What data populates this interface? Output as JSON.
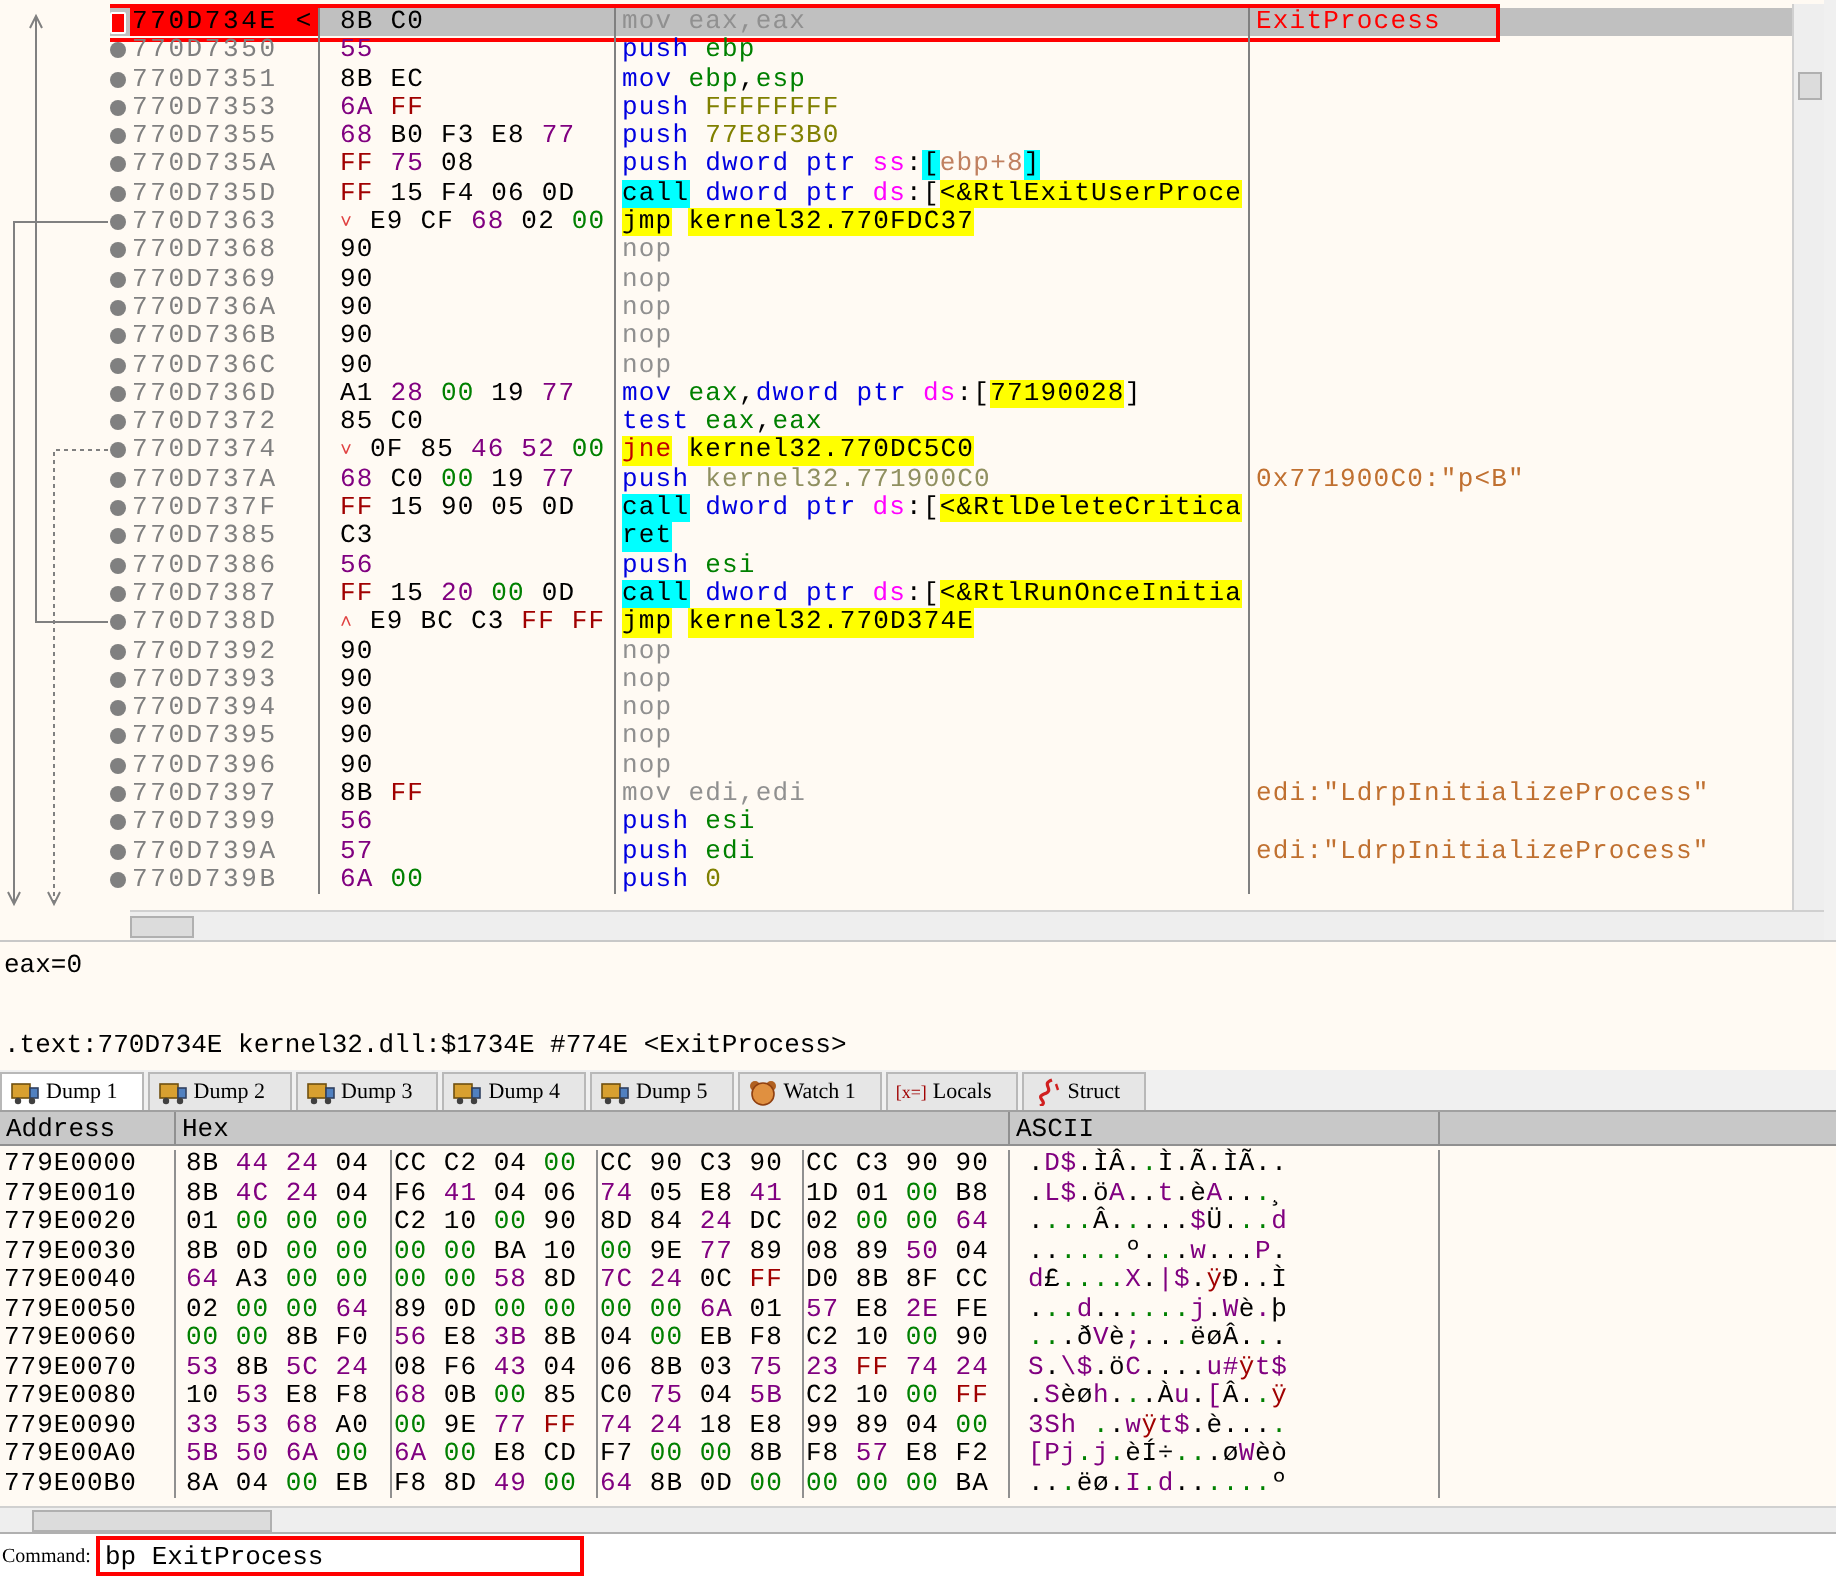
{
  "disassembly": {
    "rows": [
      {
        "address": "770D734E <",
        "bytes": "8B C0",
        "mnemonic": "mov",
        "kind": "gray",
        "operands": [
          {
            "text": "eax,eax",
            "kind": "gray"
          }
        ],
        "comment": {
          "text": "ExitProcess",
          "kind": "label"
        },
        "selected": true,
        "breakpoint": true,
        "boxed": true
      },
      {
        "address": "770D7350",
        "bytes": "55",
        "mnemonic": "push",
        "kind": "op",
        "operands": [
          {
            "text": "ebp",
            "kind": "reg"
          }
        ],
        "selected": false,
        "breakpoint": false,
        "boxed": false
      },
      {
        "address": "770D7351",
        "bytes": "8B EC",
        "mnemonic": "mov",
        "kind": "op",
        "operands": [
          {
            "text": "ebp",
            "kind": "reg"
          },
          {
            "text": ",",
            "kind": "plain"
          },
          {
            "text": "esp",
            "kind": "reg"
          }
        ],
        "selected": false,
        "breakpoint": false,
        "boxed": false
      },
      {
        "address": "770D7353",
        "bytes": "6A FF",
        "mnemonic": "push",
        "kind": "op",
        "operands": [
          {
            "text": "FFFFFFFF",
            "kind": "num"
          }
        ],
        "selected": false,
        "breakpoint": false,
        "boxed": false
      },
      {
        "address": "770D7355",
        "bytes": "68 B0 F3 E8 77",
        "mnemonic": "push",
        "kind": "op",
        "operands": [
          {
            "text": "77E8F3B0",
            "kind": "num"
          }
        ],
        "selected": false,
        "breakpoint": false,
        "boxed": false
      },
      {
        "address": "770D735A",
        "bytes": "FF 75 08",
        "mnemonic": "push",
        "kind": "op",
        "operands": [
          {
            "text": "dword ptr",
            "kind": "kw"
          },
          {
            "text": "ss",
            "kind": "seg"
          },
          {
            "text": ":",
            "kind": "plain"
          },
          {
            "text": "[",
            "kind": "brk"
          },
          {
            "text": "ebp+8",
            "kind": "mem"
          },
          {
            "text": "]",
            "kind": "brk"
          }
        ],
        "selected": false,
        "breakpoint": false,
        "boxed": false
      },
      {
        "address": "770D735D",
        "bytes": "FF 15 F4 06 0D",
        "mnemonic": "call",
        "kind": "call",
        "operands": [
          {
            "text": "dword ptr",
            "kind": "kw"
          },
          {
            "text": "ds",
            "kind": "seg"
          },
          {
            "text": ":[",
            "kind": "plain"
          },
          {
            "text": "<&RtlExitUserProce",
            "kind": "sym"
          }
        ],
        "selected": false,
        "breakpoint": false,
        "boxed": false
      },
      {
        "address": "770D7363",
        "arrow": "˅",
        "bytes": "E9 CF 68 02 00",
        "mnemonic": "jmp",
        "kind": "jump",
        "operands": [
          {
            "text": "kernel32.770FDC37",
            "kind": "sym"
          }
        ],
        "selected": false,
        "breakpoint": false,
        "boxed": false
      },
      {
        "address": "770D7368",
        "bytes": "90",
        "mnemonic": "nop",
        "kind": "gray",
        "operands": [],
        "selected": false,
        "breakpoint": false,
        "boxed": false
      },
      {
        "address": "770D7369",
        "bytes": "90",
        "mnemonic": "nop",
        "kind": "gray",
        "operands": [],
        "selected": false,
        "breakpoint": false,
        "boxed": false
      },
      {
        "address": "770D736A",
        "bytes": "90",
        "mnemonic": "nop",
        "kind": "gray",
        "operands": [],
        "selected": false,
        "breakpoint": false,
        "boxed": false
      },
      {
        "address": "770D736B",
        "bytes": "90",
        "mnemonic": "nop",
        "kind": "gray",
        "operands": [],
        "selected": false,
        "breakpoint": false,
        "boxed": false
      },
      {
        "address": "770D736C",
        "bytes": "90",
        "mnemonic": "nop",
        "kind": "gray",
        "operands": [],
        "selected": false,
        "breakpoint": false,
        "boxed": false
      },
      {
        "address": "770D736D",
        "bytes": "A1 28 00 19 77",
        "mnemonic": "mov",
        "kind": "op",
        "operands": [
          {
            "text": "eax",
            "kind": "reg"
          },
          {
            "text": ",",
            "kind": "plain"
          },
          {
            "text": "dword ptr",
            "kind": "kw"
          },
          {
            "text": "ds",
            "kind": "seg"
          },
          {
            "text": ":[",
            "kind": "plain"
          },
          {
            "text": "77190028",
            "kind": "sym"
          },
          {
            "text": "]",
            "kind": "plain"
          }
        ],
        "selected": false,
        "breakpoint": false,
        "boxed": false
      },
      {
        "address": "770D7372",
        "bytes": "85 C0",
        "mnemonic": "test",
        "kind": "op",
        "operands": [
          {
            "text": "eax",
            "kind": "reg"
          },
          {
            "text": ",",
            "kind": "plain"
          },
          {
            "text": "eax",
            "kind": "reg"
          }
        ],
        "selected": false,
        "breakpoint": false,
        "boxed": false
      },
      {
        "address": "770D7374",
        "arrow": "˅",
        "bytes": "0F 85 46 52 00",
        "mnemonic": "jne",
        "kind": "cjump",
        "operands": [
          {
            "text": "kernel32.770DC5C0",
            "kind": "sym"
          }
        ],
        "selected": false,
        "breakpoint": false,
        "boxed": false
      },
      {
        "address": "770D737A",
        "bytes": "68 C0 00 19 77",
        "mnemonic": "push",
        "kind": "op",
        "operands": [
          {
            "text": "kernel32.771900C0",
            "kind": "addr"
          }
        ],
        "comment": {
          "text": "0x771900C0:\"p<B\"",
          "kind": "string"
        },
        "selected": false,
        "breakpoint": false,
        "boxed": false
      },
      {
        "address": "770D737F",
        "bytes": "FF 15 90 05 0D",
        "mnemonic": "call",
        "kind": "call",
        "operands": [
          {
            "text": "dword ptr",
            "kind": "kw"
          },
          {
            "text": "ds",
            "kind": "seg"
          },
          {
            "text": ":[",
            "kind": "plain"
          },
          {
            "text": "<&RtlDeleteCritica",
            "kind": "sym"
          }
        ],
        "selected": false,
        "breakpoint": false,
        "boxed": false
      },
      {
        "address": "770D7385",
        "bytes": "C3",
        "mnemonic": "ret",
        "kind": "call",
        "operands": [],
        "selected": false,
        "breakpoint": false,
        "boxed": false
      },
      {
        "address": "770D7386",
        "bytes": "56",
        "mnemonic": "push",
        "kind": "op",
        "operands": [
          {
            "text": "esi",
            "kind": "reg"
          }
        ],
        "selected": false,
        "breakpoint": false,
        "boxed": false
      },
      {
        "address": "770D7387",
        "bytes": "FF 15 20 00 0D",
        "mnemonic": "call",
        "kind": "call",
        "operands": [
          {
            "text": "dword ptr",
            "kind": "kw"
          },
          {
            "text": "ds",
            "kind": "seg"
          },
          {
            "text": ":[",
            "kind": "plain"
          },
          {
            "text": "<&RtlRunOnceInitia",
            "kind": "sym"
          }
        ],
        "selected": false,
        "breakpoint": false,
        "boxed": false
      },
      {
        "address": "770D738D",
        "arrow": "˄",
        "bytes": "E9 BC C3 FF FF",
        "mnemonic": "jmp",
        "kind": "jump",
        "operands": [
          {
            "text": "kernel32.770D374E",
            "kind": "sym"
          }
        ],
        "selected": false,
        "breakpoint": false,
        "boxed": false
      },
      {
        "address": "770D7392",
        "bytes": "90",
        "mnemonic": "nop",
        "kind": "gray",
        "operands": [],
        "selected": false,
        "breakpoint": false,
        "boxed": false
      },
      {
        "address": "770D7393",
        "bytes": "90",
        "mnemonic": "nop",
        "kind": "gray",
        "operands": [],
        "selected": false,
        "breakpoint": false,
        "boxed": false
      },
      {
        "address": "770D7394",
        "bytes": "90",
        "mnemonic": "nop",
        "kind": "gray",
        "operands": [],
        "selected": false,
        "breakpoint": false,
        "boxed": false
      },
      {
        "address": "770D7395",
        "bytes": "90",
        "mnemonic": "nop",
        "kind": "gray",
        "operands": [],
        "selected": false,
        "breakpoint": false,
        "boxed": false
      },
      {
        "address": "770D7396",
        "bytes": "90",
        "mnemonic": "nop",
        "kind": "gray",
        "operands": [],
        "selected": false,
        "breakpoint": false,
        "boxed": false
      },
      {
        "address": "770D7397",
        "bytes": "8B FF",
        "mnemonic": "mov",
        "kind": "gray",
        "operands": [
          {
            "text": "edi,edi",
            "kind": "gray"
          }
        ],
        "comment": {
          "text": "edi:\"LdrpInitializeProcess\"",
          "kind": "string"
        },
        "selected": false,
        "breakpoint": false,
        "boxed": false
      },
      {
        "address": "770D7399",
        "bytes": "56",
        "mnemonic": "push",
        "kind": "op",
        "operands": [
          {
            "text": "esi",
            "kind": "reg"
          }
        ],
        "selected": false,
        "breakpoint": false,
        "boxed": false
      },
      {
        "address": "770D739A",
        "bytes": "57",
        "mnemonic": "push",
        "kind": "op",
        "operands": [
          {
            "text": "edi",
            "kind": "reg"
          }
        ],
        "comment": {
          "text": "edi:\"LdrpInitializeProcess\"",
          "kind": "string"
        },
        "selected": false,
        "breakpoint": false,
        "boxed": false
      },
      {
        "address": "770D739B",
        "bytes": "6A 00",
        "mnemonic": "push",
        "kind": "op",
        "operands": [
          {
            "text": "0",
            "kind": "num"
          }
        ],
        "selected": false,
        "breakpoint": false,
        "boxed": false
      }
    ]
  },
  "info": {
    "register": "eax=0",
    "location": ".text:770D734E kernel32.dll:$1734E #774E <ExitProcess>"
  },
  "tabs": [
    {
      "label": "Dump 1",
      "kind": "dump",
      "selected": true
    },
    {
      "label": "Dump 2",
      "kind": "dump",
      "selected": false
    },
    {
      "label": "Dump 3",
      "kind": "dump",
      "selected": false
    },
    {
      "label": "Dump 4",
      "kind": "dump",
      "selected": false
    },
    {
      "label": "Dump 5",
      "kind": "dump",
      "selected": false
    },
    {
      "label": "Watch 1",
      "kind": "watch",
      "selected": false
    },
    {
      "label": "Locals",
      "kind": "locals",
      "icon_text": "[x=]",
      "selected": false
    },
    {
      "label": "Struct",
      "kind": "struct",
      "selected": false
    }
  ],
  "dump": {
    "columns": [
      "Address",
      "Hex",
      "ASCII"
    ],
    "rows": [
      {
        "address": "779E0000",
        "hex": "8B 44 24 04 CC C2 04 00 CC 90 C3 90 CC C3 90 90",
        "ascii": ".D$.ÌÂ..Ì.Ã.ÌÃ.."
      },
      {
        "address": "779E0010",
        "hex": "8B 4C 24 04 F6 41 04 06 74 05 E8 41 1D 01 00 B8",
        "ascii": ".L$.öA..t.èA...¸"
      },
      {
        "address": "779E0020",
        "hex": "01 00 00 00 C2 10 00 90 8D 84 24 DC 02 00 00 64",
        "ascii": "....Â.....$Ü...d"
      },
      {
        "address": "779E0030",
        "hex": "8B 0D 00 00 00 00 BA 10 00 9E 77 89 08 89 50 04",
        "ascii": "......º...w...P."
      },
      {
        "address": "779E0040",
        "hex": "64 A3 00 00 00 00 58 8D 7C 24 0C FF D0 8B 8F CC",
        "ascii": "d£....X.|$.ÿÐ..Ì"
      },
      {
        "address": "779E0050",
        "hex": "02 00 00 64 89 0D 00 00 00 00 6A 01 57 E8 2E FE",
        "ascii": "...d......j.Wè.þ"
      },
      {
        "address": "779E0060",
        "hex": "00 00 8B F0 56 E8 3B 8B 04 00 EB F8 C2 10 00 90",
        "ascii": "...ðVè;...ëøÂ..."
      },
      {
        "address": "779E0070",
        "hex": "53 8B 5C 24 08 F6 43 04 06 8B 03 75 23 FF 74 24",
        "ascii": "S.\\$.öC....u#ÿt$"
      },
      {
        "address": "779E0080",
        "hex": "10 53 E8 F8 68 0B 00 85 C0 75 04 5B C2 10 00 FF",
        "ascii": ".Sèøh...Àu.[Â..ÿ"
      },
      {
        "address": "779E0090",
        "hex": "33 53 68 A0 00 9E 77 FF 74 24 18 E8 99 89 04 00",
        "ascii": "3Sh ..wÿt$.è...."
      },
      {
        "address": "779E00A0",
        "hex": "5B 50 6A 00 6A 00 E8 CD F7 00 00 8B F8 57 E8 F2",
        "ascii": "[Pj.j.èÍ÷...øWèò"
      },
      {
        "address": "779E00B0",
        "hex": "8A 04 00 EB F8 8D 49 00 64 8B 0D 00 00 00 00 BA",
        "ascii": "...ëø.I.d......º"
      }
    ]
  },
  "command": {
    "label": "Command:",
    "value": "bp ExitProcess",
    "boxed": true
  }
}
